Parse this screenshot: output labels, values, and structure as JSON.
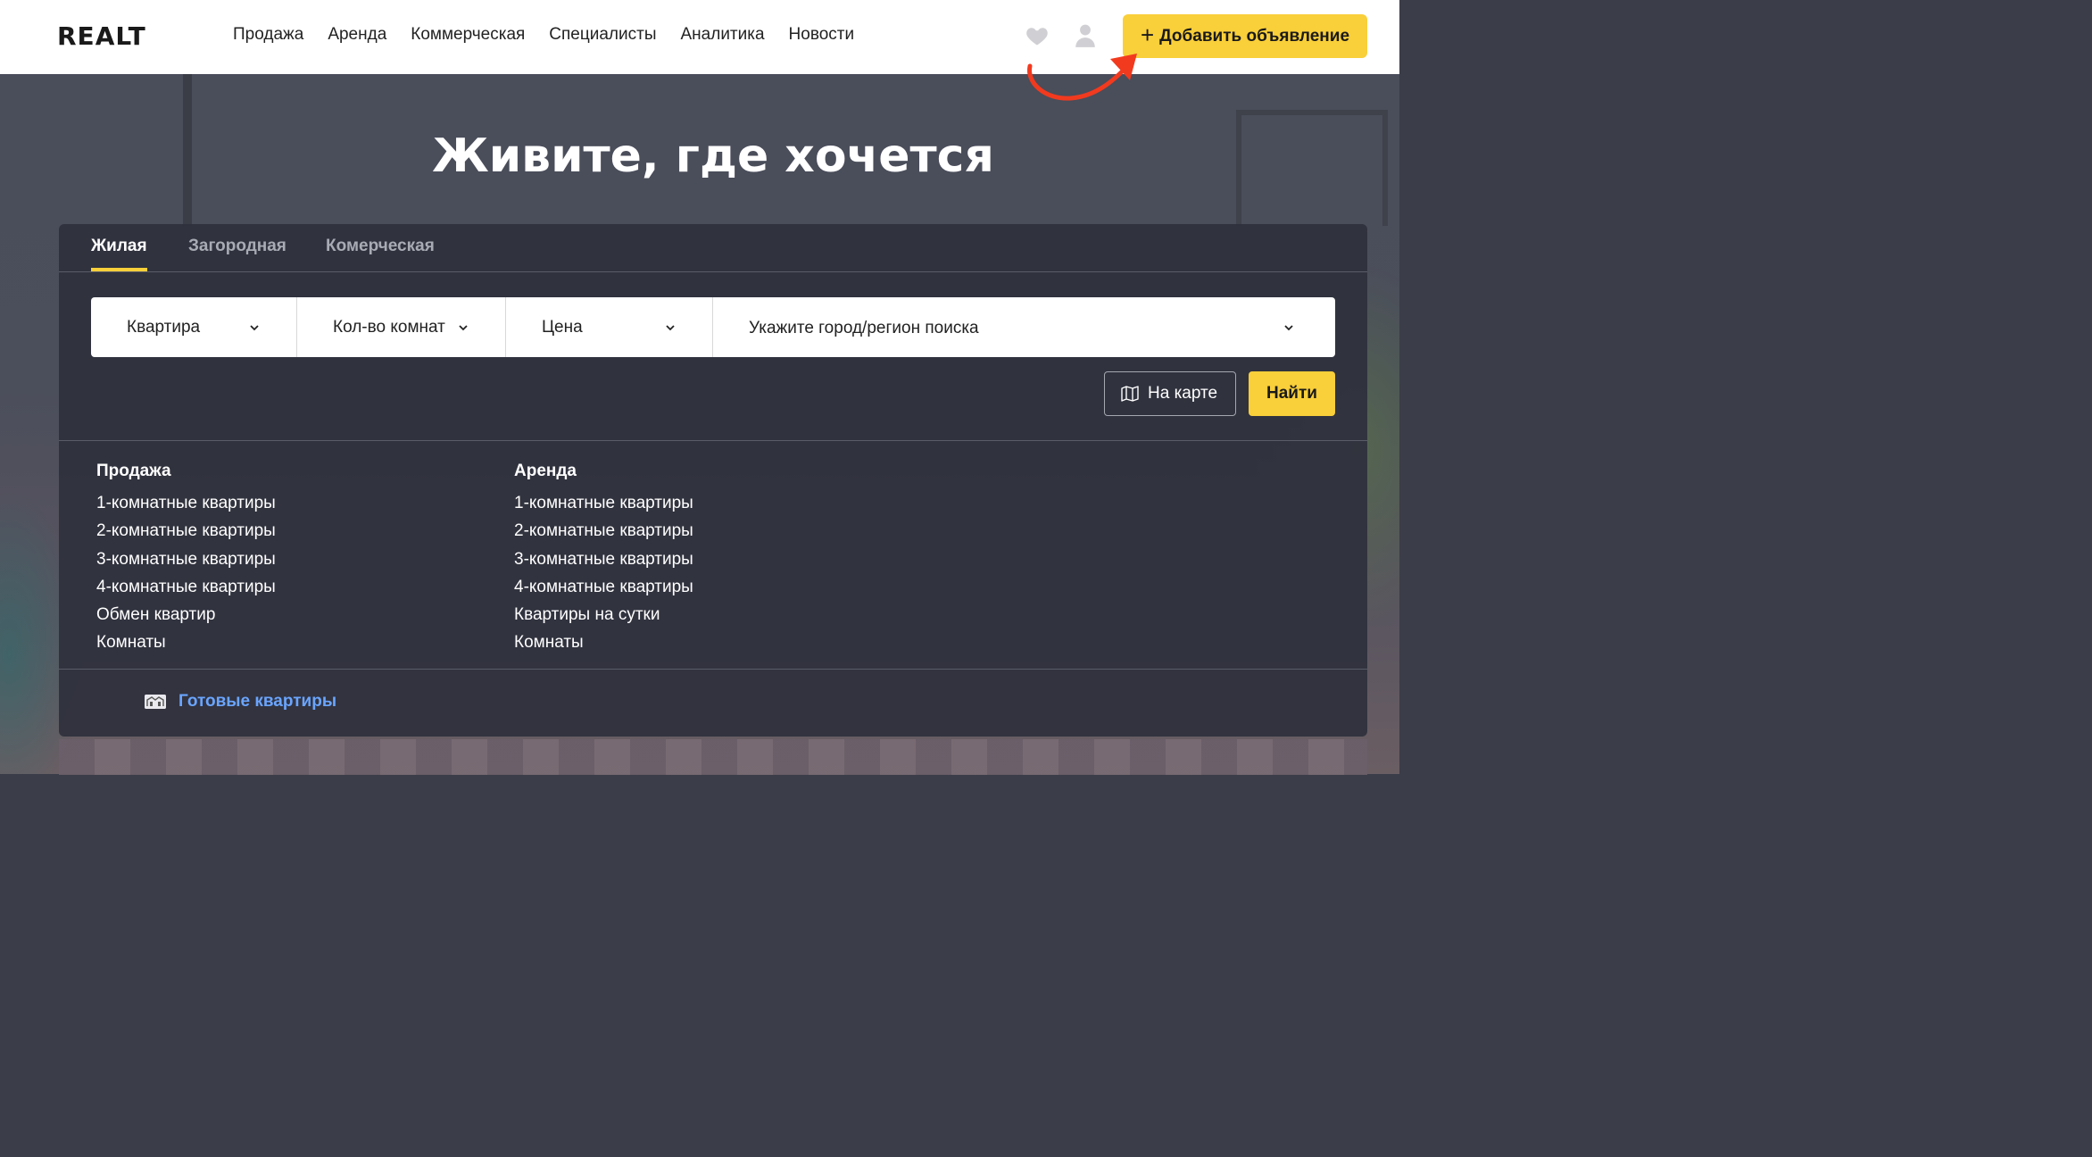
{
  "header": {
    "logo": "REALT",
    "nav": [
      "Продажа",
      "Аренда",
      "Коммерческая",
      "Специалисты",
      "Аналитика",
      "Новости"
    ],
    "add_button": "Добавить объявление",
    "add_button_icon": "plus-icon",
    "accent_color": "#f9cf3a",
    "annotation_arrow_color": "#f23a1f"
  },
  "hero": {
    "headline": "Живите, где хочется"
  },
  "search": {
    "tabs": [
      "Жилая",
      "Загородная",
      "Комерческая"
    ],
    "active_tab": "Жилая",
    "filters": {
      "type": "Квартира",
      "rooms": "Кол-во комнат",
      "price": "Цена",
      "location_placeholder": "Укажите город/регион поиска"
    },
    "map_button": "На карте",
    "find_button": "Найти"
  },
  "links": {
    "sale": {
      "title": "Продажа",
      "items": [
        "1-комнатные квартиры",
        "2-комнатные квартиры",
        "3-комнатные квартиры",
        "4-комнатные квартиры",
        "Обмен квартир",
        "Комнаты"
      ]
    },
    "rent": {
      "title": "Аренда",
      "items": [
        "1-комнатные квартиры",
        "2-комнатные квартиры",
        "3-комнатные квартиры",
        "4-комнатные квартиры",
        "Квартиры на сутки",
        "Комнаты"
      ]
    }
  },
  "ready": {
    "label": "Готовые квартиры",
    "link_color": "#6aa5ff"
  }
}
